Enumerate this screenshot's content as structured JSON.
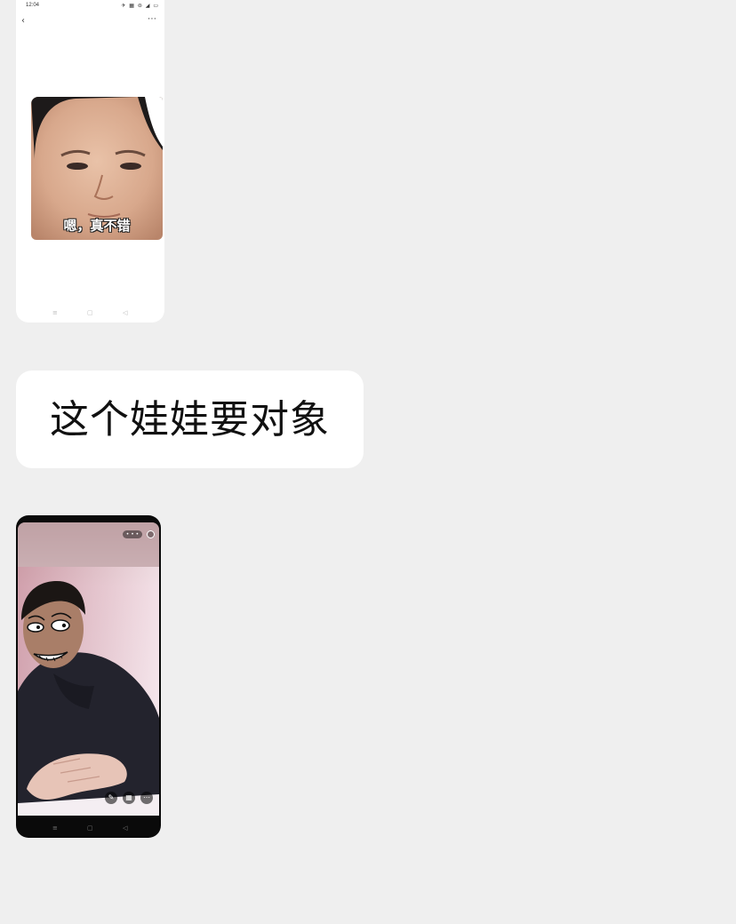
{
  "message1": {
    "status_time": "12:04",
    "status_icons": "✈ ▦ ⊜ ◢ ▭",
    "back_icon": "chevron-left-icon",
    "more_icon": "more-icon",
    "sticker_caption": "嗯，真不错",
    "nav_icons": [
      "≡",
      "▢",
      "◁"
    ]
  },
  "message2": {
    "text": "这个娃娃要对象"
  },
  "message3": {
    "top_pill": "• • •",
    "tool_icons": [
      "edit-icon",
      "grid-icon",
      "more-icon"
    ],
    "tool_glyphs": [
      "✎",
      "▦",
      "⋯"
    ],
    "nav_icons": [
      "≡",
      "▢",
      "◁"
    ]
  }
}
